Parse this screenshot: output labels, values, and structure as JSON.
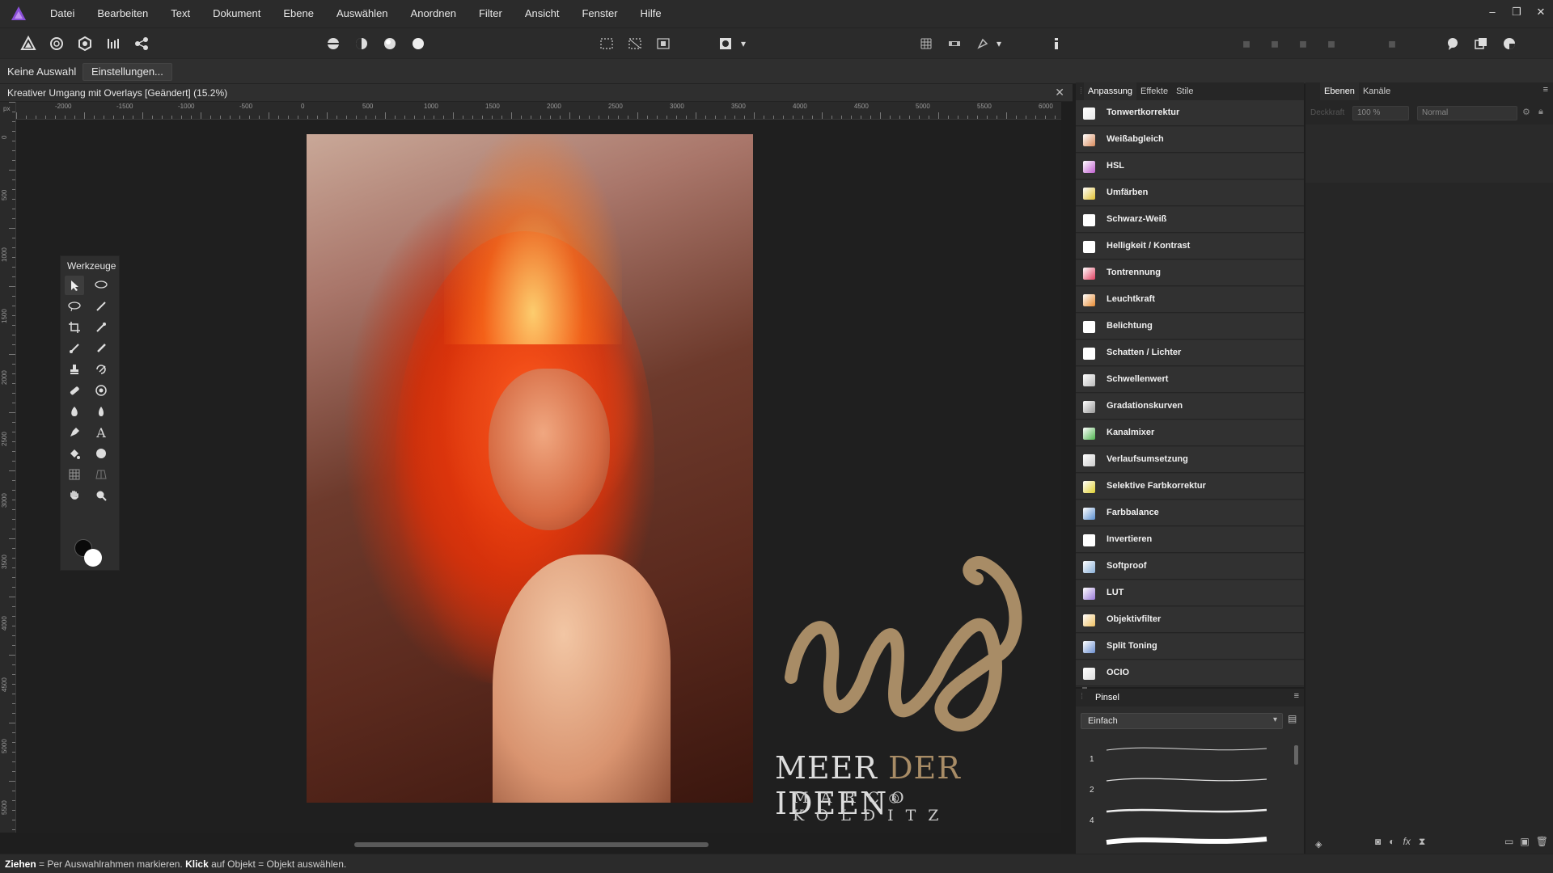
{
  "menubar": {
    "items": [
      "Datei",
      "Bearbeiten",
      "Text",
      "Dokument",
      "Ebene",
      "Auswählen",
      "Anordnen",
      "Filter",
      "Ansicht",
      "Fenster",
      "Hilfe"
    ]
  },
  "contextbar": {
    "no_selection": "Keine Auswahl",
    "settings_button": "Einstellungen..."
  },
  "document": {
    "title": "Kreativer Umgang mit Overlays [Geändert] (15.2%)",
    "close": "✕"
  },
  "ruler": {
    "h_labels": [
      "-2000",
      "-1500",
      "-1000",
      "-500",
      "0",
      "500",
      "1000",
      "1500",
      "2000",
      "2500",
      "3000",
      "3500",
      "4000",
      "4500",
      "5000",
      "5500",
      "6000"
    ],
    "v_labels": [
      "0",
      "500",
      "1000",
      "1500",
      "2000",
      "2500",
      "3000",
      "3500",
      "4000",
      "4500",
      "5000",
      "5500"
    ],
    "unit": "px"
  },
  "tools_panel": {
    "title": "Werkzeuge"
  },
  "logo": {
    "line1_a": "MEER ",
    "line1_b": "DER",
    "line1_c": " IDEEN",
    "registered": "®",
    "line2": "MARCO KOLDITZ"
  },
  "adjustment_panel": {
    "tabs": [
      "Anpassung",
      "Effekte",
      "Stile"
    ],
    "items": [
      {
        "label": "Tonwertkorrektur",
        "icon": "levels-icon",
        "color": "#e8e8e8"
      },
      {
        "label": "Weißabgleich",
        "icon": "white-balance-icon",
        "color": "#d98a5a"
      },
      {
        "label": "HSL",
        "icon": "hsl-icon",
        "color": "#c05fd0"
      },
      {
        "label": "Umfärben",
        "icon": "recolor-icon",
        "color": "#e0c030"
      },
      {
        "label": "Schwarz-Weiß",
        "icon": "black-white-icon",
        "color": "#ffffff"
      },
      {
        "label": "Helligkeit / Kontrast",
        "icon": "brightness-contrast-icon",
        "color": "#ffffff"
      },
      {
        "label": "Tontrennung",
        "icon": "posterize-icon",
        "color": "#e04060"
      },
      {
        "label": "Leuchtkraft",
        "icon": "vibrance-icon",
        "color": "#e88b30"
      },
      {
        "label": "Belichtung",
        "icon": "exposure-icon",
        "color": "#ffffff"
      },
      {
        "label": "Schatten / Lichter",
        "icon": "shadows-highlights-icon",
        "color": "#ffffff"
      },
      {
        "label": "Schwellenwert",
        "icon": "threshold-icon",
        "color": "#bbbbbb"
      },
      {
        "label": "Gradationskurven",
        "icon": "curves-icon",
        "color": "#999999"
      },
      {
        "label": "Kanalmixer",
        "icon": "channel-mixer-icon",
        "color": "#4fb34f"
      },
      {
        "label": "Verlaufsumsetzung",
        "icon": "gradient-map-icon",
        "color": "#cccccc"
      },
      {
        "label": "Selektive Farbkorrektur",
        "icon": "selective-color-icon",
        "color": "#e0d030"
      },
      {
        "label": "Farbbalance",
        "icon": "color-balance-icon",
        "color": "#5a8fd0"
      },
      {
        "label": "Invertieren",
        "icon": "invert-icon",
        "color": "#ffffff"
      },
      {
        "label": "Softproof",
        "icon": "soft-proof-icon",
        "color": "#8ab0d8"
      },
      {
        "label": "LUT",
        "icon": "lut-icon",
        "color": "#9a7ad8"
      },
      {
        "label": "Objektivfilter",
        "icon": "lens-filter-icon",
        "color": "#f0c060"
      },
      {
        "label": "Split Toning",
        "icon": "split-toning-icon",
        "color": "#6b8fcf"
      },
      {
        "label": "OCIO",
        "icon": "ocio-icon",
        "color": "#dddddd"
      }
    ]
  },
  "brush_panel": {
    "title": "Pinsel",
    "category": "Einfach",
    "sizes": [
      "1",
      "2",
      "4"
    ]
  },
  "layers_panel": {
    "tabs": [
      "Ebenen",
      "Kanäle"
    ],
    "opacity_label": "Deckkraft",
    "opacity": "100 %",
    "blend_mode": "Normal"
  },
  "statusbar": {
    "drag_bold": "Ziehen",
    "drag_text": " = Per Auswahlrahmen markieren. ",
    "click_bold": "Klick",
    "click_text": " auf Objekt = Objekt auswählen."
  },
  "colors": {
    "accent": "#5b8fd6",
    "logo_gold": "#a88c66",
    "panel_bg": "#2c2c2c",
    "menubar_bg": "#2b2b2b"
  }
}
